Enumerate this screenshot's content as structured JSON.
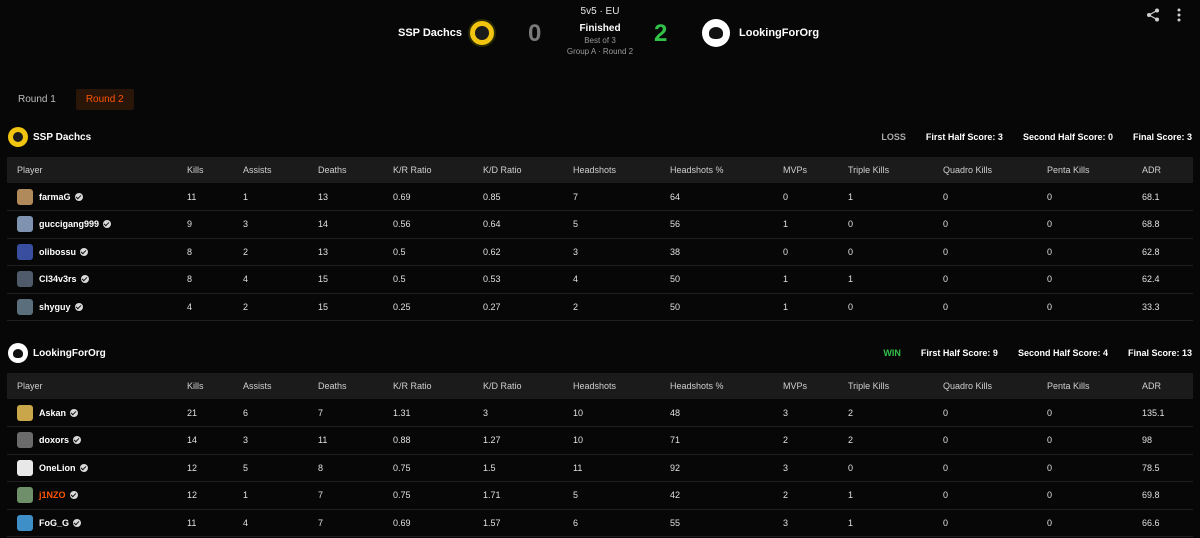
{
  "match": {
    "mode": "5v5 · EU",
    "status": "Finished",
    "best_of": "Best of 3",
    "group": "Group A · Round 2",
    "team_a": {
      "name": "SSP Dachcs",
      "score": "0"
    },
    "team_b": {
      "name": "LookingForOrg",
      "score": "2"
    }
  },
  "icons": {
    "share": "share-icon",
    "more": "more-vertical-icon",
    "verified": "verified-check-icon"
  },
  "colors": {
    "accent": "#ff5500",
    "win": "#32c24a",
    "team_a_logo": "#f1c40f"
  },
  "rounds": [
    {
      "label": "Round 1",
      "active": false
    },
    {
      "label": "Round 2",
      "active": true
    }
  ],
  "columns": [
    "Player",
    "Kills",
    "Assists",
    "Deaths",
    "K/R Ratio",
    "K/D Ratio",
    "Headshots",
    "Headshots %",
    "MVPs",
    "Triple Kills",
    "Quadro Kills",
    "Penta Kills",
    "ADR"
  ],
  "teams": [
    {
      "name": "SSP Dachcs",
      "result": "LOSS",
      "first_half": "First Half Score: 3",
      "second_half": "Second Half Score: 0",
      "final": "Final Score: 3",
      "players": [
        {
          "name": "farmaG",
          "avatar": "#b08a5a",
          "highlight": false,
          "stats": [
            "11",
            "1",
            "13",
            "0.69",
            "0.85",
            "7",
            "64",
            "0",
            "1",
            "0",
            "0",
            "68.1"
          ]
        },
        {
          "name": "guccigang999",
          "avatar": "#7f93b0",
          "highlight": false,
          "stats": [
            "9",
            "3",
            "14",
            "0.56",
            "0.64",
            "5",
            "56",
            "1",
            "0",
            "0",
            "0",
            "68.8"
          ]
        },
        {
          "name": "olibossu",
          "avatar": "#3a4ea0",
          "highlight": false,
          "stats": [
            "8",
            "2",
            "13",
            "0.5",
            "0.62",
            "3",
            "38",
            "0",
            "0",
            "0",
            "0",
            "62.8"
          ]
        },
        {
          "name": "Cl34v3rs",
          "avatar": "#4f5a6a",
          "highlight": false,
          "stats": [
            "8",
            "4",
            "15",
            "0.5",
            "0.53",
            "4",
            "50",
            "1",
            "1",
            "0",
            "0",
            "62.4"
          ]
        },
        {
          "name": "shyguy",
          "avatar": "#5b6e7c",
          "highlight": false,
          "stats": [
            "4",
            "2",
            "15",
            "0.25",
            "0.27",
            "2",
            "50",
            "1",
            "0",
            "0",
            "0",
            "33.3"
          ]
        }
      ]
    },
    {
      "name": "LookingForOrg",
      "result": "WIN",
      "first_half": "First Half Score: 9",
      "second_half": "Second Half Score: 4",
      "final": "Final Score: 13",
      "players": [
        {
          "name": "Askan",
          "avatar": "#c9a64a",
          "highlight": false,
          "stats": [
            "21",
            "6",
            "7",
            "1.31",
            "3",
            "10",
            "48",
            "3",
            "2",
            "0",
            "0",
            "135.1"
          ]
        },
        {
          "name": "doxors",
          "avatar": "#6a6a6a",
          "highlight": false,
          "stats": [
            "14",
            "3",
            "11",
            "0.88",
            "1.27",
            "10",
            "71",
            "2",
            "2",
            "0",
            "0",
            "98"
          ]
        },
        {
          "name": "OneLion",
          "avatar": "#e8e8e8",
          "highlight": false,
          "stats": [
            "12",
            "5",
            "8",
            "0.75",
            "1.5",
            "11",
            "92",
            "3",
            "0",
            "0",
            "0",
            "78.5"
          ]
        },
        {
          "name": "j1NZO",
          "avatar": "#6f8f6a",
          "highlight": true,
          "stats": [
            "12",
            "1",
            "7",
            "0.75",
            "1.71",
            "5",
            "42",
            "2",
            "1",
            "0",
            "0",
            "69.8"
          ]
        },
        {
          "name": "FoG_G",
          "avatar": "#3e8fc7",
          "highlight": false,
          "stats": [
            "11",
            "4",
            "7",
            "0.69",
            "1.57",
            "6",
            "55",
            "3",
            "1",
            "0",
            "0",
            "66.6"
          ]
        }
      ]
    }
  ]
}
